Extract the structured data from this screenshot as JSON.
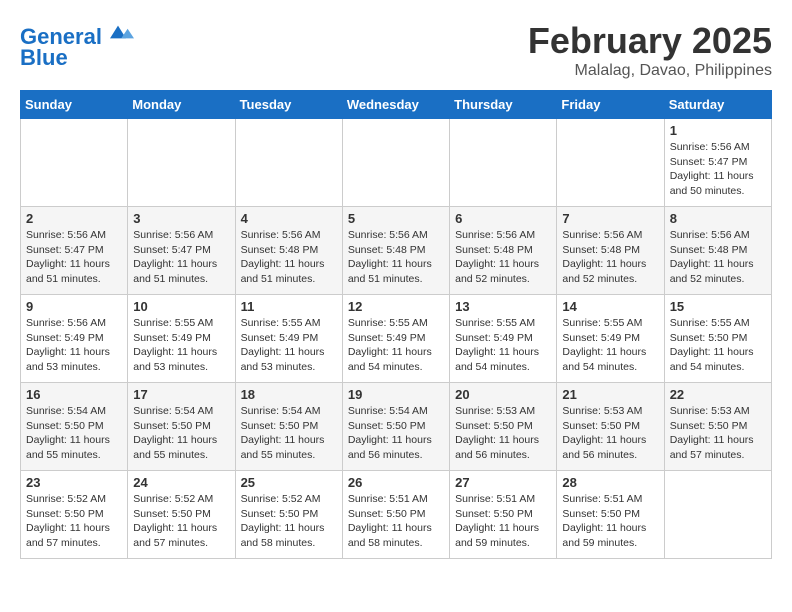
{
  "logo": {
    "line1": "General",
    "line2": "Blue"
  },
  "title": "February 2025",
  "subtitle": "Malalag, Davao, Philippines",
  "weekdays": [
    "Sunday",
    "Monday",
    "Tuesday",
    "Wednesday",
    "Thursday",
    "Friday",
    "Saturday"
  ],
  "weeks": [
    [
      {
        "day": "",
        "info": ""
      },
      {
        "day": "",
        "info": ""
      },
      {
        "day": "",
        "info": ""
      },
      {
        "day": "",
        "info": ""
      },
      {
        "day": "",
        "info": ""
      },
      {
        "day": "",
        "info": ""
      },
      {
        "day": "1",
        "info": "Sunrise: 5:56 AM\nSunset: 5:47 PM\nDaylight: 11 hours\nand 50 minutes."
      }
    ],
    [
      {
        "day": "2",
        "info": "Sunrise: 5:56 AM\nSunset: 5:47 PM\nDaylight: 11 hours\nand 51 minutes."
      },
      {
        "day": "3",
        "info": "Sunrise: 5:56 AM\nSunset: 5:47 PM\nDaylight: 11 hours\nand 51 minutes."
      },
      {
        "day": "4",
        "info": "Sunrise: 5:56 AM\nSunset: 5:48 PM\nDaylight: 11 hours\nand 51 minutes."
      },
      {
        "day": "5",
        "info": "Sunrise: 5:56 AM\nSunset: 5:48 PM\nDaylight: 11 hours\nand 51 minutes."
      },
      {
        "day": "6",
        "info": "Sunrise: 5:56 AM\nSunset: 5:48 PM\nDaylight: 11 hours\nand 52 minutes."
      },
      {
        "day": "7",
        "info": "Sunrise: 5:56 AM\nSunset: 5:48 PM\nDaylight: 11 hours\nand 52 minutes."
      },
      {
        "day": "8",
        "info": "Sunrise: 5:56 AM\nSunset: 5:48 PM\nDaylight: 11 hours\nand 52 minutes."
      }
    ],
    [
      {
        "day": "9",
        "info": "Sunrise: 5:56 AM\nSunset: 5:49 PM\nDaylight: 11 hours\nand 53 minutes."
      },
      {
        "day": "10",
        "info": "Sunrise: 5:55 AM\nSunset: 5:49 PM\nDaylight: 11 hours\nand 53 minutes."
      },
      {
        "day": "11",
        "info": "Sunrise: 5:55 AM\nSunset: 5:49 PM\nDaylight: 11 hours\nand 53 minutes."
      },
      {
        "day": "12",
        "info": "Sunrise: 5:55 AM\nSunset: 5:49 PM\nDaylight: 11 hours\nand 54 minutes."
      },
      {
        "day": "13",
        "info": "Sunrise: 5:55 AM\nSunset: 5:49 PM\nDaylight: 11 hours\nand 54 minutes."
      },
      {
        "day": "14",
        "info": "Sunrise: 5:55 AM\nSunset: 5:49 PM\nDaylight: 11 hours\nand 54 minutes."
      },
      {
        "day": "15",
        "info": "Sunrise: 5:55 AM\nSunset: 5:50 PM\nDaylight: 11 hours\nand 54 minutes."
      }
    ],
    [
      {
        "day": "16",
        "info": "Sunrise: 5:54 AM\nSunset: 5:50 PM\nDaylight: 11 hours\nand 55 minutes."
      },
      {
        "day": "17",
        "info": "Sunrise: 5:54 AM\nSunset: 5:50 PM\nDaylight: 11 hours\nand 55 minutes."
      },
      {
        "day": "18",
        "info": "Sunrise: 5:54 AM\nSunset: 5:50 PM\nDaylight: 11 hours\nand 55 minutes."
      },
      {
        "day": "19",
        "info": "Sunrise: 5:54 AM\nSunset: 5:50 PM\nDaylight: 11 hours\nand 56 minutes."
      },
      {
        "day": "20",
        "info": "Sunrise: 5:53 AM\nSunset: 5:50 PM\nDaylight: 11 hours\nand 56 minutes."
      },
      {
        "day": "21",
        "info": "Sunrise: 5:53 AM\nSunset: 5:50 PM\nDaylight: 11 hours\nand 56 minutes."
      },
      {
        "day": "22",
        "info": "Sunrise: 5:53 AM\nSunset: 5:50 PM\nDaylight: 11 hours\nand 57 minutes."
      }
    ],
    [
      {
        "day": "23",
        "info": "Sunrise: 5:52 AM\nSunset: 5:50 PM\nDaylight: 11 hours\nand 57 minutes."
      },
      {
        "day": "24",
        "info": "Sunrise: 5:52 AM\nSunset: 5:50 PM\nDaylight: 11 hours\nand 57 minutes."
      },
      {
        "day": "25",
        "info": "Sunrise: 5:52 AM\nSunset: 5:50 PM\nDaylight: 11 hours\nand 58 minutes."
      },
      {
        "day": "26",
        "info": "Sunrise: 5:51 AM\nSunset: 5:50 PM\nDaylight: 11 hours\nand 58 minutes."
      },
      {
        "day": "27",
        "info": "Sunrise: 5:51 AM\nSunset: 5:50 PM\nDaylight: 11 hours\nand 59 minutes."
      },
      {
        "day": "28",
        "info": "Sunrise: 5:51 AM\nSunset: 5:50 PM\nDaylight: 11 hours\nand 59 minutes."
      },
      {
        "day": "",
        "info": ""
      }
    ]
  ]
}
